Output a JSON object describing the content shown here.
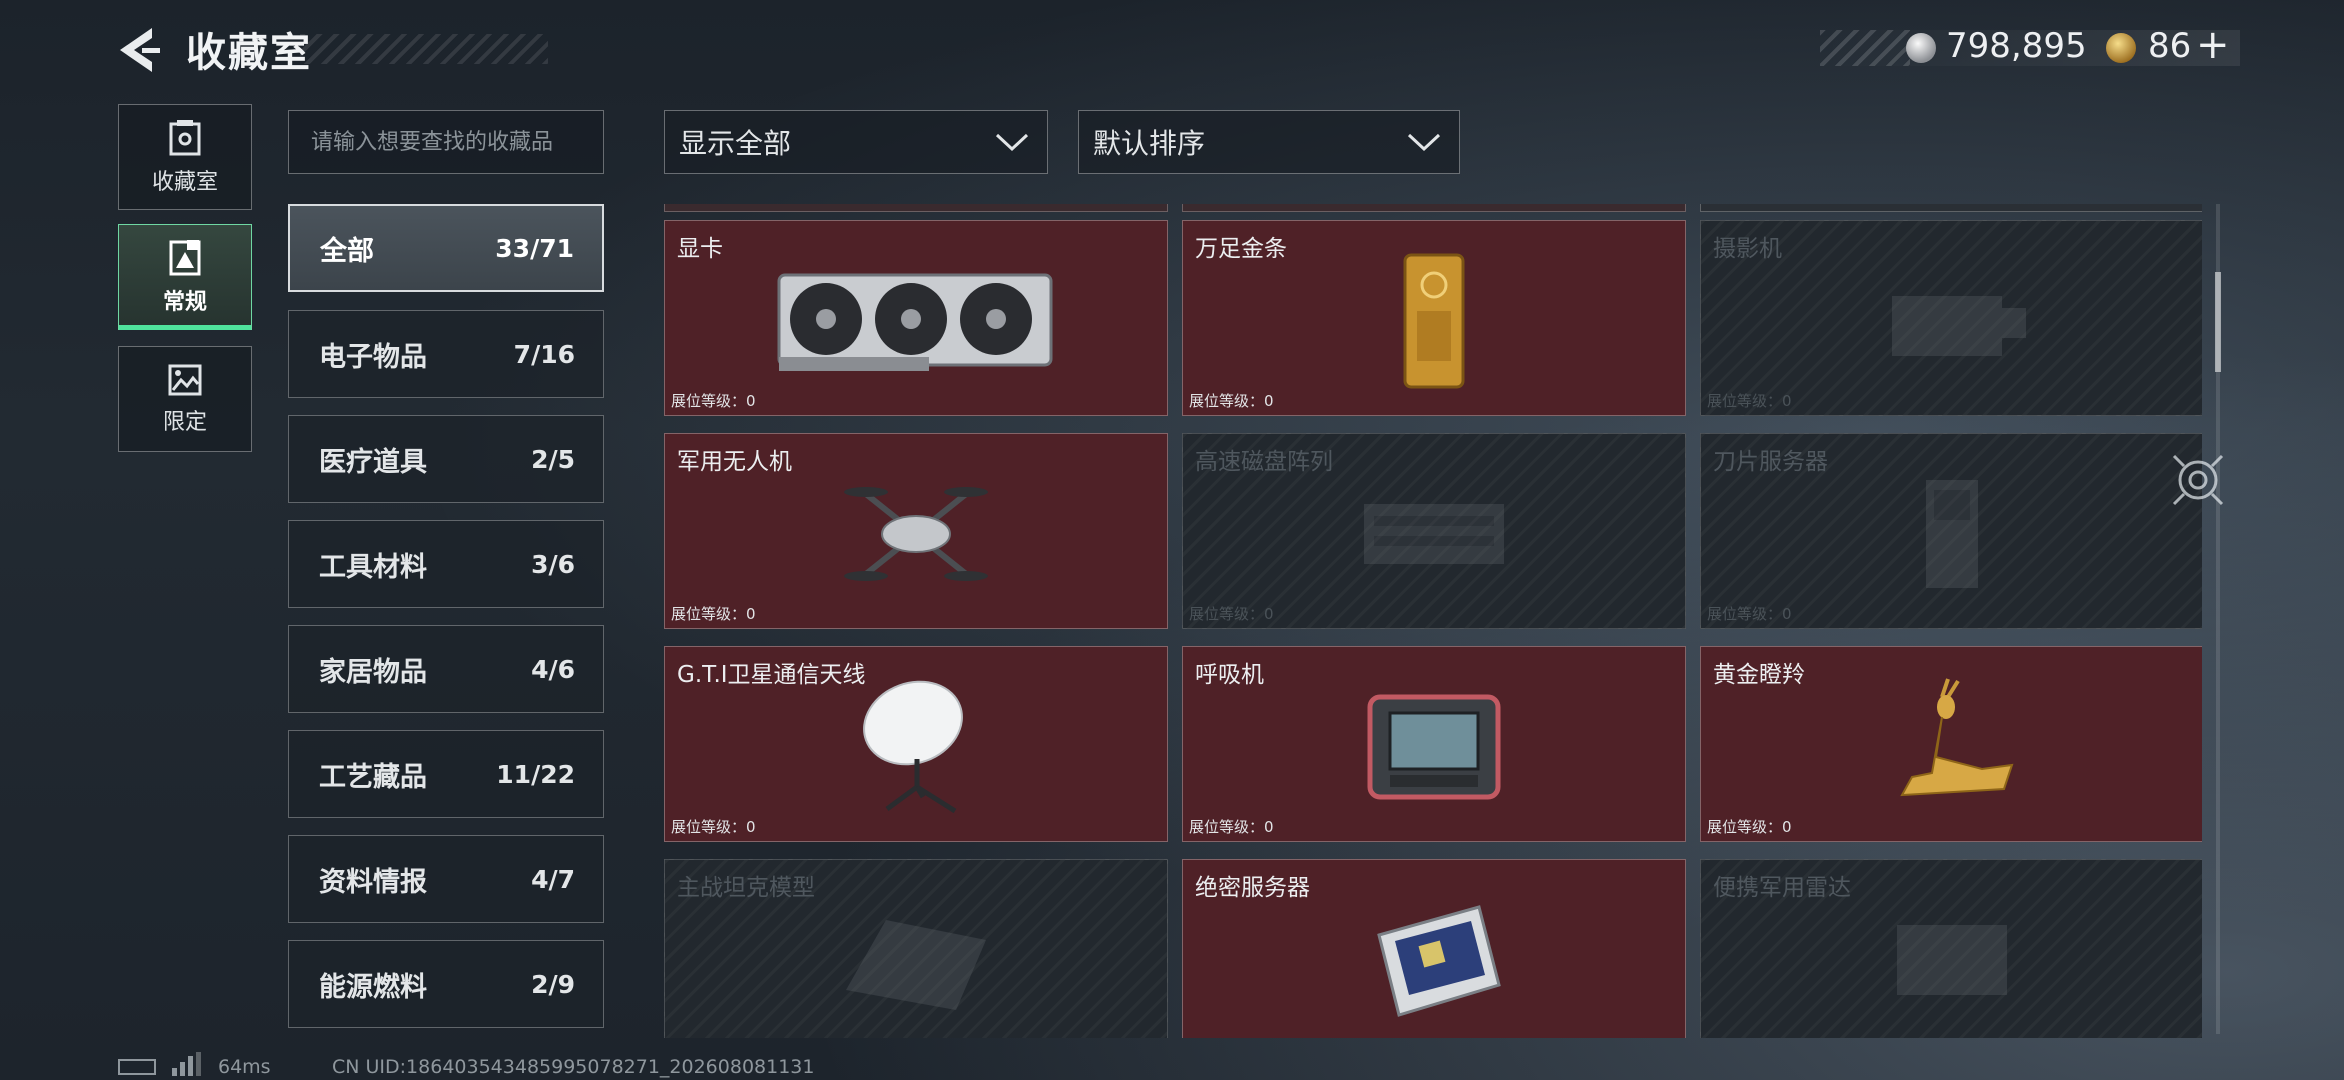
{
  "header": {
    "title": "收藏室",
    "money": "798,895",
    "tickets": "86",
    "plus": "+"
  },
  "mode_tabs": [
    {
      "label": "收藏室",
      "icon": "vault-icon",
      "active": false
    },
    {
      "label": "常规",
      "icon": "image-frame-icon",
      "active": true
    },
    {
      "label": "限定",
      "icon": "landscape-icon",
      "active": false
    }
  ],
  "search": {
    "placeholder": "请输入想要查找的收藏品"
  },
  "categories": [
    {
      "name": "全部",
      "count": "33/71",
      "active": true
    },
    {
      "name": "电子物品",
      "count": "7/16"
    },
    {
      "name": "医疗道具",
      "count": "2/5"
    },
    {
      "name": "工具材料",
      "count": "3/6"
    },
    {
      "name": "家居物品",
      "count": "4/6"
    },
    {
      "name": "工艺藏品",
      "count": "11/22"
    },
    {
      "name": "资料情报",
      "count": "4/7"
    },
    {
      "name": "能源燃料",
      "count": "2/9"
    }
  ],
  "filters": {
    "display": "显示全部",
    "sort": "默认排序"
  },
  "items": [
    {
      "name": "显卡",
      "level": "展位等级：0",
      "owned": true,
      "icon": "graphics-card-icon"
    },
    {
      "name": "万足金条",
      "level": "展位等级：0",
      "owned": true,
      "icon": "gold-bar-icon"
    },
    {
      "name": "摄影机",
      "level": "展位等级：0",
      "owned": false,
      "icon": "camera-icon"
    },
    {
      "name": "军用无人机",
      "level": "展位等级：0",
      "owned": true,
      "icon": "drone-icon"
    },
    {
      "name": "高速磁盘阵列",
      "level": "展位等级：0",
      "owned": false,
      "icon": "disk-array-icon"
    },
    {
      "name": "刀片服务器",
      "level": "展位等级：0",
      "owned": false,
      "icon": "blade-server-icon"
    },
    {
      "name": "G.T.I卫星通信天线",
      "level": "展位等级：0",
      "owned": true,
      "icon": "satellite-dish-icon"
    },
    {
      "name": "呼吸机",
      "level": "展位等级：0",
      "owned": true,
      "icon": "ventilator-icon"
    },
    {
      "name": "黄金瞪羚",
      "level": "展位等级：0",
      "owned": true,
      "icon": "golden-gazelle-icon"
    },
    {
      "name": "主战坦克模型",
      "level": "",
      "owned": false,
      "icon": "tank-model-icon"
    },
    {
      "name": "绝密服务器",
      "level": "",
      "owned": true,
      "icon": "server-icon"
    },
    {
      "name": "便携军用雷达",
      "level": "",
      "owned": false,
      "icon": "radar-icon"
    }
  ],
  "status": {
    "ping": "64ms",
    "uid": "CN UID:1864035434859950782​71_202608081131"
  }
}
